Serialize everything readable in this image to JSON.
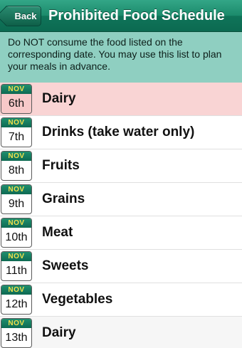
{
  "navbar": {
    "back_label": "Back",
    "title": "Prohibited Food Schedule"
  },
  "notice": {
    "text": "Do NOT consume the food listed on the corresponding date. You may use this list to plan your meals in advance."
  },
  "colors": {
    "navbar": "#1b8a6b",
    "notice_background": "#8fcfc1",
    "highlight_row": "#f9d4d4",
    "calendar_month_text": "#f2e14a"
  },
  "schedule": [
    {
      "month": "NOV",
      "day": "6th",
      "food": "Dairy",
      "highlighted": true
    },
    {
      "month": "NOV",
      "day": "7th",
      "food": "Drinks (take water only)"
    },
    {
      "month": "NOV",
      "day": "8th",
      "food": "Fruits"
    },
    {
      "month": "NOV",
      "day": "9th",
      "food": "Grains"
    },
    {
      "month": "NOV",
      "day": "10th",
      "food": "Meat"
    },
    {
      "month": "NOV",
      "day": "11th",
      "food": "Sweets"
    },
    {
      "month": "NOV",
      "day": "12th",
      "food": "Vegetables"
    },
    {
      "month": "NOV",
      "day": "13th",
      "food": "Dairy"
    }
  ]
}
